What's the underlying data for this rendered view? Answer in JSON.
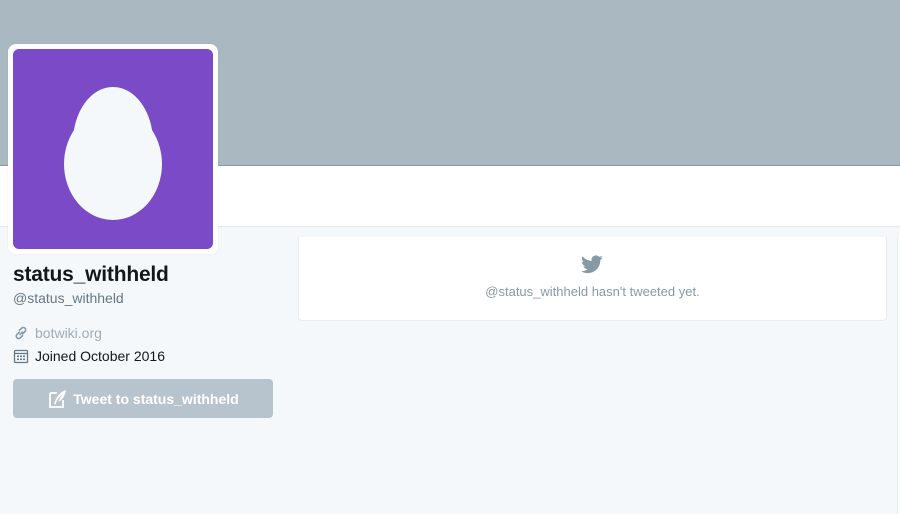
{
  "profile": {
    "name": "status_withheld",
    "handle": "@status_withheld",
    "url": "botwiki.org",
    "joined": "Joined October 2016",
    "avatar_color": "#7b4ac6",
    "banner_color": "#aab8c2"
  },
  "actions": {
    "tweet_to_label": "Tweet to status_withheld"
  },
  "timeline": {
    "empty_message": "@status_withheld hasn't tweeted yet."
  },
  "icons": {
    "link": "link-icon",
    "calendar": "calendar-icon",
    "compose": "compose-icon",
    "bird": "bird-icon",
    "avatar": "egg-icon"
  }
}
